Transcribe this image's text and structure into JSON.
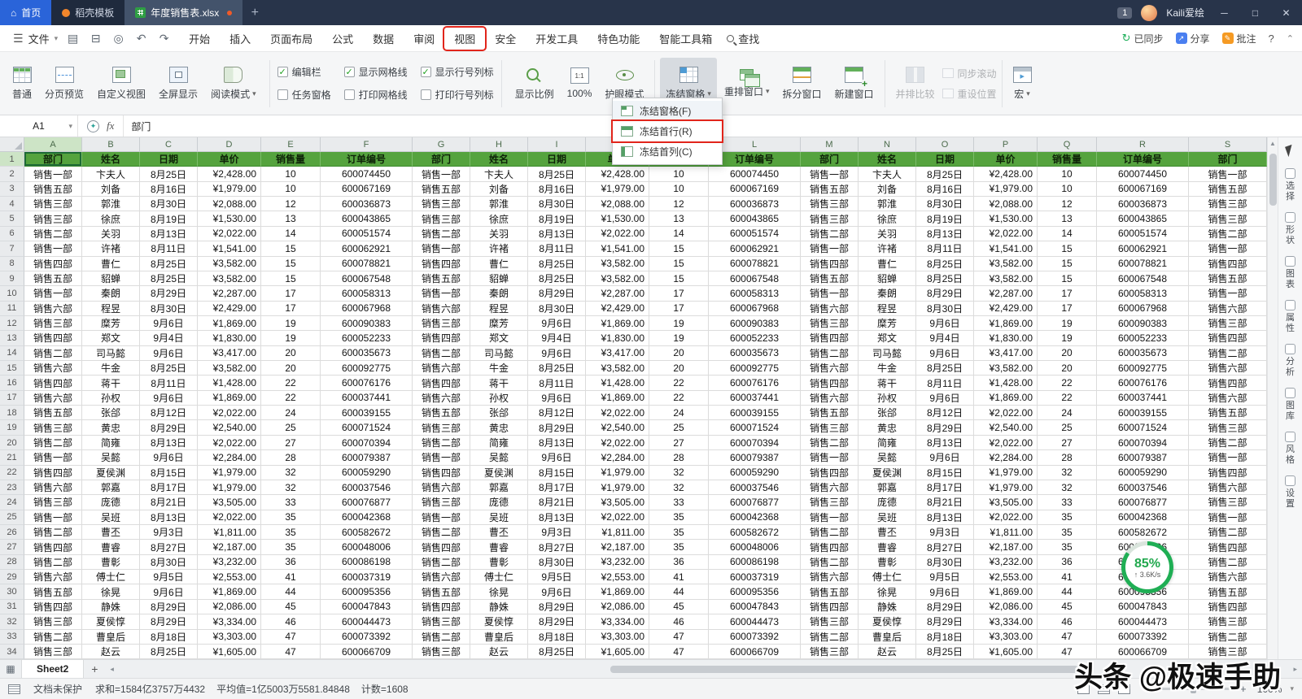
{
  "titlebar": {
    "home_tab": "首页",
    "template_tab": "稻壳模板",
    "doc_tab": "年度销售表.xlsx",
    "new_tab": "+",
    "downloads_badge": "1",
    "user_name": "Kaili爱绘",
    "window": {
      "minimize": "─",
      "maximize": "□",
      "close": "✕"
    }
  },
  "menubar": {
    "file_label": "文件",
    "tabs": [
      "开始",
      "插入",
      "页面布局",
      "公式",
      "数据",
      "审阅",
      "视图",
      "安全",
      "开发工具",
      "特色功能",
      "智能工具箱"
    ],
    "annotated_tab": "视图",
    "search_label": "查找",
    "sync_label": "已同步",
    "share_label": "分享",
    "comment_label": "批注",
    "help_label": "?"
  },
  "ribbon": {
    "view_buttons": [
      {
        "label": "普通",
        "icon": "normal-view-icon"
      },
      {
        "label": "分页预览",
        "icon": "page-break-preview-icon"
      },
      {
        "label": "自定义视图",
        "icon": "custom-view-icon"
      },
      {
        "label": "全屏显示",
        "icon": "fullscreen-icon"
      },
      {
        "label": "阅读模式",
        "icon": "reading-mode-icon",
        "dropdown": true
      }
    ],
    "checkboxes": [
      {
        "label": "编辑栏",
        "checked": true
      },
      {
        "label": "任务窗格",
        "checked": false
      },
      {
        "label": "显示网格线",
        "checked": true
      },
      {
        "label": "打印网格线",
        "checked": false
      },
      {
        "label": "显示行号列标",
        "checked": true
      },
      {
        "label": "打印行号列标",
        "checked": false
      }
    ],
    "tool_groups": [
      {
        "buttons": [
          {
            "label": "显示比例",
            "icon": "zoom-scale-icon"
          },
          {
            "label": "100%",
            "icon": "zoom-100-icon"
          },
          {
            "label": "护眼模式",
            "icon": "eye-protection-icon"
          }
        ]
      },
      {
        "buttons": [
          {
            "label": "冻结窗格",
            "icon": "freeze-panes-icon",
            "dropdown": true,
            "pressed": true
          },
          {
            "label": "重排窗口",
            "icon": "arrange-windows-icon",
            "dropdown": true
          },
          {
            "label": "拆分窗口",
            "icon": "split-window-icon"
          },
          {
            "label": "新建窗口",
            "icon": "new-window-icon"
          }
        ]
      },
      {
        "buttons": [
          {
            "label": "并排比较",
            "icon": "side-by-side-icon",
            "disabled": true
          }
        ],
        "small_buttons": [
          {
            "label": "同步滚动",
            "icon": "sync-scroll-icon",
            "disabled": true
          },
          {
            "label": "重设位置",
            "icon": "reset-position-icon",
            "disabled": true
          }
        ]
      },
      {
        "buttons": [
          {
            "label": "宏",
            "icon": "macro-icon",
            "dropdown": true
          }
        ]
      }
    ]
  },
  "freeze_menu": {
    "items": [
      {
        "label": "冻结窗格(F)",
        "icon": "freeze-panes-item-icon"
      },
      {
        "label": "冻结首行(R)",
        "icon": "freeze-top-row-icon",
        "annotated": true
      },
      {
        "label": "冻结首列(C)",
        "icon": "freeze-first-column-icon"
      }
    ]
  },
  "formula_bar": {
    "name_box": "A1",
    "fx_label": "fx",
    "value": "部门"
  },
  "sheet": {
    "columns": [
      "A",
      "B",
      "C",
      "D",
      "E",
      "F",
      "G",
      "H",
      "I",
      "J",
      "K",
      "L",
      "M",
      "N",
      "O",
      "P",
      "Q",
      "R",
      "S"
    ],
    "header_labels": [
      "部门",
      "姓名",
      "日期",
      "单价",
      "销售量",
      "订单编号"
    ],
    "rows": [
      [
        "销售一部",
        "卞夫人",
        "8月25日",
        "¥2,428.00",
        "10",
        "600074450"
      ],
      [
        "销售五部",
        "刘备",
        "8月16日",
        "¥1,979.00",
        "10",
        "600067169"
      ],
      [
        "销售三部",
        "郭淮",
        "8月30日",
        "¥2,088.00",
        "12",
        "600036873"
      ],
      [
        "销售三部",
        "徐庶",
        "8月19日",
        "¥1,530.00",
        "13",
        "600043865"
      ],
      [
        "销售二部",
        "关羽",
        "8月13日",
        "¥2,022.00",
        "14",
        "600051574"
      ],
      [
        "销售一部",
        "许褚",
        "8月11日",
        "¥1,541.00",
        "15",
        "600062921"
      ],
      [
        "销售四部",
        "曹仁",
        "8月25日",
        "¥3,582.00",
        "15",
        "600078821"
      ],
      [
        "销售五部",
        "貂蝉",
        "8月25日",
        "¥3,582.00",
        "15",
        "600067548"
      ],
      [
        "销售一部",
        "秦朗",
        "8月29日",
        "¥2,287.00",
        "17",
        "600058313"
      ],
      [
        "销售六部",
        "程昱",
        "8月30日",
        "¥2,429.00",
        "17",
        "600067968"
      ],
      [
        "销售三部",
        "糜芳",
        "9月6日",
        "¥1,869.00",
        "19",
        "600090383"
      ],
      [
        "销售四部",
        "郑文",
        "9月4日",
        "¥1,830.00",
        "19",
        "600052233"
      ],
      [
        "销售二部",
        "司马懿",
        "9月6日",
        "¥3,417.00",
        "20",
        "600035673"
      ],
      [
        "销售六部",
        "牛金",
        "8月25日",
        "¥3,582.00",
        "20",
        "600092775"
      ],
      [
        "销售四部",
        "蒋干",
        "8月11日",
        "¥1,428.00",
        "22",
        "600076176"
      ],
      [
        "销售六部",
        "孙权",
        "9月6日",
        "¥1,869.00",
        "22",
        "600037441"
      ],
      [
        "销售五部",
        "张郃",
        "8月12日",
        "¥2,022.00",
        "24",
        "600039155"
      ],
      [
        "销售三部",
        "黄忠",
        "8月29日",
        "¥2,540.00",
        "25",
        "600071524"
      ],
      [
        "销售二部",
        "简雍",
        "8月13日",
        "¥2,022.00",
        "27",
        "600070394"
      ],
      [
        "销售一部",
        "吴懿",
        "9月6日",
        "¥2,284.00",
        "28",
        "600079387"
      ],
      [
        "销售四部",
        "夏侯渊",
        "8月15日",
        "¥1,979.00",
        "32",
        "600059290"
      ],
      [
        "销售六部",
        "郭嘉",
        "8月17日",
        "¥1,979.00",
        "32",
        "600037546"
      ],
      [
        "销售三部",
        "庞德",
        "8月21日",
        "¥3,505.00",
        "33",
        "600076877"
      ],
      [
        "销售一部",
        "吴班",
        "8月13日",
        "¥2,022.00",
        "35",
        "600042368"
      ],
      [
        "销售二部",
        "曹丕",
        "9月3日",
        "¥1,811.00",
        "35",
        "600582672"
      ],
      [
        "销售四部",
        "曹睿",
        "8月27日",
        "¥2,187.00",
        "35",
        "600048006"
      ],
      [
        "销售二部",
        "曹彰",
        "8月30日",
        "¥3,232.00",
        "36",
        "600086198"
      ],
      [
        "销售六部",
        "傅士仁",
        "9月5日",
        "¥2,553.00",
        "41",
        "600037319"
      ],
      [
        "销售五部",
        "徐晃",
        "9月6日",
        "¥1,869.00",
        "44",
        "600095356"
      ],
      [
        "销售四部",
        "静姝",
        "8月29日",
        "¥2,086.00",
        "45",
        "600047843"
      ],
      [
        "销售三部",
        "夏侯惇",
        "8月29日",
        "¥3,334.00",
        "46",
        "600044473"
      ],
      [
        "销售二部",
        "曹皇后",
        "8月18日",
        "¥3,303.00",
        "47",
        "600073392"
      ],
      [
        "销售三部",
        "赵云",
        "8月25日",
        "¥1,605.00",
        "47",
        "600066709"
      ]
    ]
  },
  "sheet_tabs": {
    "active": "Sheet2",
    "add_label": "+"
  },
  "status_bar": {
    "protection": "文档未保护",
    "sum": "求和=1584亿3757万4432",
    "average": "平均值=1亿5003万5581.84848",
    "count": "计数=1608",
    "zoom": "100%"
  },
  "sidebar": {
    "items": [
      "选择",
      "形状",
      "图表",
      "属性",
      "分析",
      "图库",
      "风格",
      "设置"
    ]
  },
  "overlay": {
    "progress_percent": "85%",
    "speed": "↑ 3.6K/s"
  },
  "watermark": "头条 @极速手助",
  "colors": {
    "accent_green": "#55a33e",
    "annotation_red": "#e1251b",
    "titlebar": "#28344a"
  }
}
